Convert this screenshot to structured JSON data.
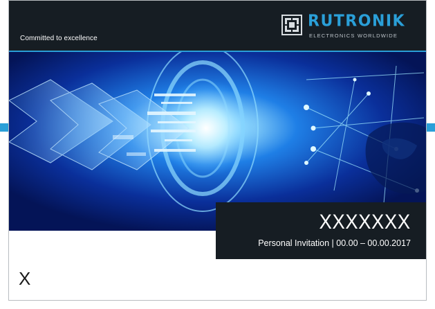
{
  "header": {
    "tagline": "Committed to excellence",
    "logo_word": "RUTRONIK",
    "logo_sub": "ELECTRONICS WORLDWIDE"
  },
  "hero": {
    "image": "abstract blue digital technology background"
  },
  "invitation": {
    "title": "XXXXXXX",
    "subtitle": "Personal Invitation | 00.00 – 00.00.2017"
  },
  "body": {
    "text": "X"
  },
  "colors": {
    "brand_blue": "#2a9fd8",
    "dark": "#161d23"
  }
}
